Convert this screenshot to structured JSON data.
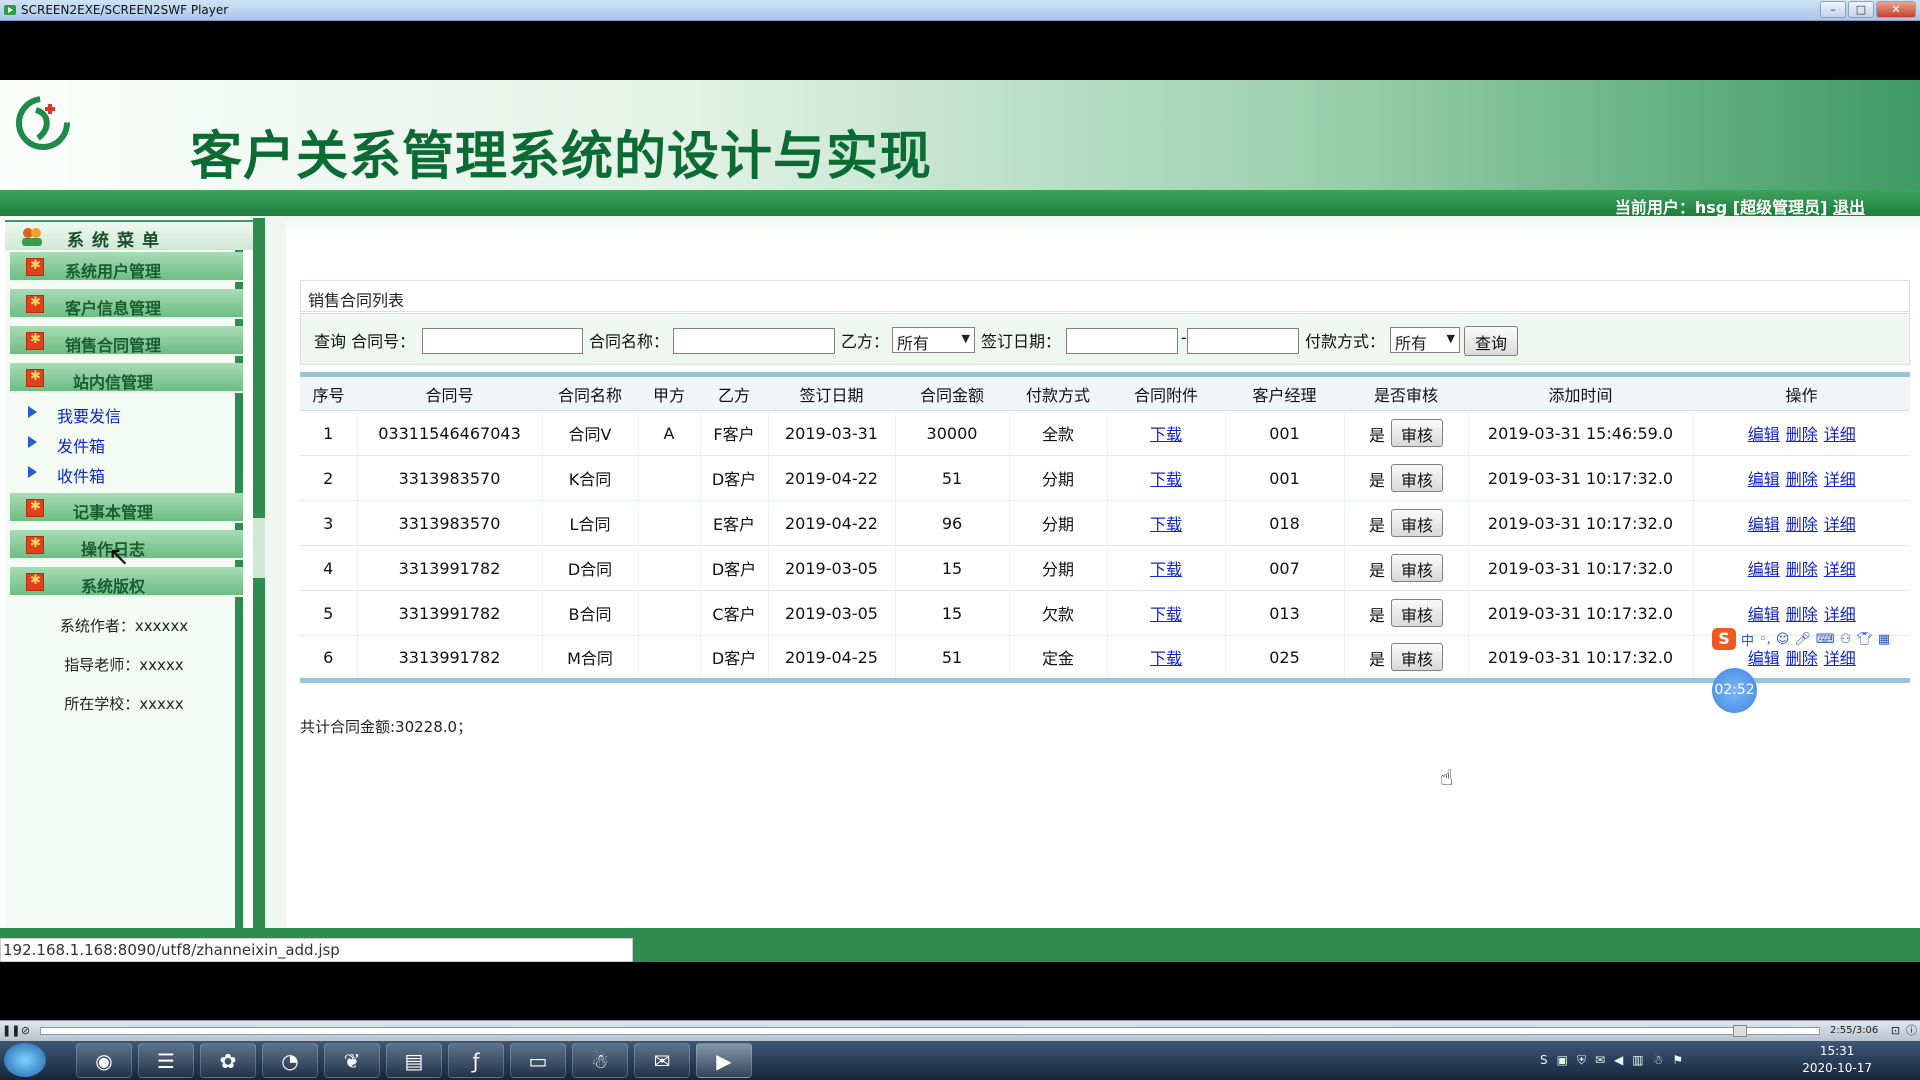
{
  "window": {
    "title": "SCREEN2EXE/SCREEN2SWF Player",
    "minimize": "–",
    "maximize": "□",
    "close": "✕"
  },
  "header": {
    "system_title": "客户关系管理系统的设计与实现",
    "current_user_prefix": "当前用户：hsg [超级管理员] ",
    "logout": "退出"
  },
  "sidebar": {
    "heading": "系统菜单",
    "items": [
      {
        "label": "系统用户管理"
      },
      {
        "label": "客户信息管理"
      },
      {
        "label": "销售合同管理"
      },
      {
        "label": "站内信管理"
      }
    ],
    "subitems": [
      {
        "label": "我要发信"
      },
      {
        "label": "发件箱"
      },
      {
        "label": "收件箱"
      }
    ],
    "items2": [
      {
        "label": "记事本管理"
      },
      {
        "label": "操作日志"
      },
      {
        "label": "系统版权"
      }
    ],
    "info": [
      "系统作者：xxxxxx",
      "指导老师：xxxxx",
      "所在学校：xxxxx"
    ]
  },
  "panel": {
    "title": "销售合同列表",
    "search": {
      "query_label": "查询 合同号：",
      "name_label": "合同名称：",
      "party_b_label": "乙方：",
      "party_b_value": "所有",
      "date_label": "签订日期：",
      "date_sep": "-",
      "pay_label": "付款方式：",
      "pay_value": "所有",
      "button": "查询"
    },
    "columns": [
      "序号",
      "合同号",
      "合同名称",
      "甲方",
      "乙方",
      "签订日期",
      "合同金额",
      "付款方式",
      "合同附件",
      "客户经理",
      "是否审核",
      "添加时间",
      "操作"
    ],
    "rows": [
      {
        "no": "1",
        "code": "03311546467043",
        "name": "合同V",
        "a": "A",
        "b": "F客户",
        "date": "2019-03-31",
        "amount": "30000",
        "pay": "全款",
        "file": "下载",
        "mgr": "001",
        "audited": "是",
        "added": "2019-03-31 15:46:59.0"
      },
      {
        "no": "2",
        "code": "3313983570",
        "name": "K合同",
        "a": "",
        "b": "D客户",
        "date": "2019-04-22",
        "amount": "51",
        "pay": "分期",
        "file": "下载",
        "mgr": "001",
        "audited": "是",
        "added": "2019-03-31 10:17:32.0"
      },
      {
        "no": "3",
        "code": "3313983570",
        "name": "L合同",
        "a": "",
        "b": "E客户",
        "date": "2019-04-22",
        "amount": "96",
        "pay": "分期",
        "file": "下载",
        "mgr": "018",
        "audited": "是",
        "added": "2019-03-31 10:17:32.0"
      },
      {
        "no": "4",
        "code": "3313991782",
        "name": "D合同",
        "a": "",
        "b": "D客户",
        "date": "2019-03-05",
        "amount": "15",
        "pay": "分期",
        "file": "下载",
        "mgr": "007",
        "audited": "是",
        "added": "2019-03-31 10:17:32.0"
      },
      {
        "no": "5",
        "code": "3313991782",
        "name": "B合同",
        "a": "",
        "b": "C客户",
        "date": "2019-03-05",
        "amount": "15",
        "pay": "欠款",
        "file": "下载",
        "mgr": "013",
        "audited": "是",
        "added": "2019-03-31 10:17:32.0"
      },
      {
        "no": "6",
        "code": "3313991782",
        "name": "M合同",
        "a": "",
        "b": "D客户",
        "date": "2019-04-25",
        "amount": "51",
        "pay": "定金",
        "file": "下载",
        "mgr": "025",
        "audited": "是",
        "added": "2019-03-31 10:17:32.0"
      }
    ],
    "audit_label": "审核",
    "ops": [
      "编辑",
      "删除",
      "详细"
    ],
    "total": "共计合同金额:30228.0；"
  },
  "status_url": "192.168.1.168:8090/utf8/zhanneixin_add.jsp",
  "ime": {
    "logo": "S",
    "mode": "中"
  },
  "timer": "02:52",
  "player": {
    "time": "2:55/3:06",
    "progress": 0.955
  },
  "taskbar": {
    "clock_time": "15:31",
    "clock_date": "2020-10-17"
  }
}
